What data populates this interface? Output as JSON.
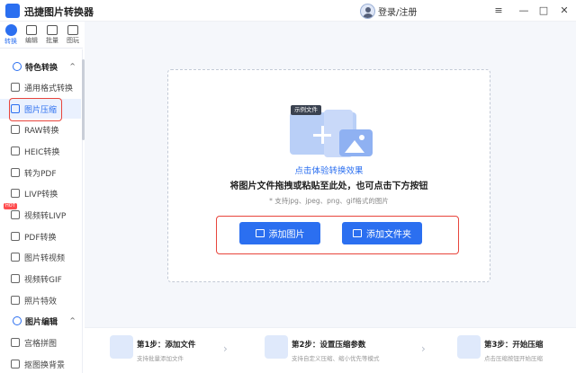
{
  "app": {
    "title": "迅捷图片转换器",
    "login": "登录/注册",
    "brand_color": "#2b6ff0",
    "highlight_color": "#e8453c"
  },
  "window_controls": {
    "menu": "≡",
    "minimize": "—",
    "maximize": "□",
    "close": "✕"
  },
  "tabs": [
    {
      "label": "转换",
      "icon": "convert-icon",
      "active": true
    },
    {
      "label": "编辑",
      "icon": "edit-icon"
    },
    {
      "label": "批量",
      "icon": "batch-icon"
    },
    {
      "label": "图玩",
      "icon": "play-icon"
    }
  ],
  "sidebar": {
    "section1": {
      "label": "特色转换",
      "chevron": "^"
    },
    "items": [
      {
        "label": "通用格式转换"
      },
      {
        "label": "图片压缩",
        "active": true
      },
      {
        "label": "RAW转换"
      },
      {
        "label": "HEIC转换"
      },
      {
        "label": "转为PDF"
      },
      {
        "label": "LIVP转换"
      },
      {
        "label": "视频转LIVP",
        "badge": "HOT"
      },
      {
        "label": "PDF转换"
      },
      {
        "label": "图片转视频"
      },
      {
        "label": "视频转GIF"
      },
      {
        "label": "照片特效"
      }
    ],
    "section2": {
      "label": "图片编辑",
      "chevron": "^"
    },
    "items2": [
      {
        "label": "宫格拼图"
      },
      {
        "label": "抠图换背景"
      }
    ]
  },
  "dropzone": {
    "sample_tag": "示例文件",
    "try_link": "点击体验转换效果",
    "instruction": "将图片文件拖拽或粘贴至此处，也可点击下方按钮",
    "support": "* 支持jpg、jpeg、png、gif格式的图片",
    "add_image": "添加图片",
    "add_folder": "添加文件夹"
  },
  "steps": [
    {
      "title": "第1步：添加文件",
      "desc": "支持批量添加文件"
    },
    {
      "title": "第2步：设置压缩参数",
      "desc": "支持自定义压缩、缩小优先等模式"
    },
    {
      "title": "第3步：开始压缩",
      "desc": "点击压缩按钮开始压缩"
    }
  ],
  "step_arrow": "›"
}
